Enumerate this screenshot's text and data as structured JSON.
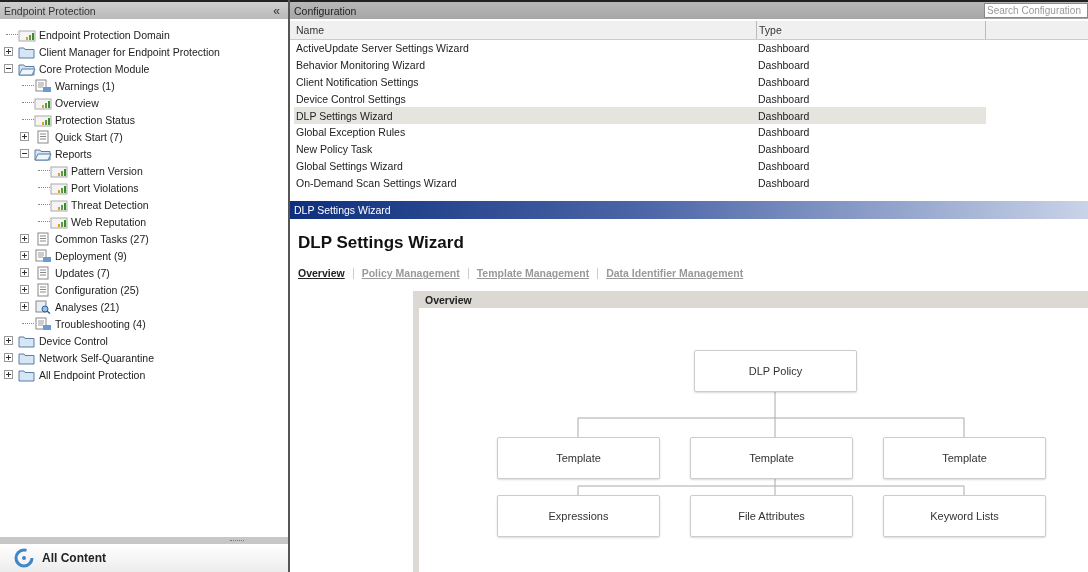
{
  "sidebar": {
    "title": "Endpoint Protection",
    "collapse": "«",
    "tree": [
      {
        "label": "Endpoint Protection Domain",
        "kind": "report"
      },
      {
        "label": "Client Manager for Endpoint Protection",
        "kind": "folder",
        "expanded": false
      },
      {
        "label": "Core Protection Module",
        "kind": "folder",
        "expanded": true,
        "children": [
          {
            "label": "Warnings (1)",
            "kind": "document"
          },
          {
            "label": "Overview",
            "kind": "report"
          },
          {
            "label": "Protection Status",
            "kind": "report"
          },
          {
            "label": "Quick Start (7)",
            "kind": "list",
            "expanded": false
          },
          {
            "label": "Reports",
            "kind": "folder",
            "expanded": true,
            "children": [
              {
                "label": "Pattern Version",
                "kind": "report"
              },
              {
                "label": "Port Violations",
                "kind": "report"
              },
              {
                "label": "Threat Detection",
                "kind": "report"
              },
              {
                "label": "Web Reputation",
                "kind": "report"
              }
            ]
          },
          {
            "label": "Common Tasks (27)",
            "kind": "list",
            "expanded": false
          },
          {
            "label": "Deployment (9)",
            "kind": "document",
            "expanded": false
          },
          {
            "label": "Updates (7)",
            "kind": "list",
            "expanded": false
          },
          {
            "label": "Configuration (25)",
            "kind": "list",
            "expanded": false
          },
          {
            "label": "Analyses (21)",
            "kind": "analysis",
            "expanded": false
          },
          {
            "label": "Troubleshooting (4)",
            "kind": "document"
          }
        ]
      },
      {
        "label": "Device Control",
        "kind": "folder",
        "expanded": false
      },
      {
        "label": "Network Self-Quarantine",
        "kind": "folder",
        "expanded": false
      },
      {
        "label": "All Endpoint Protection",
        "kind": "folder",
        "expanded": false
      }
    ],
    "footer": "All Content"
  },
  "configuration": {
    "title": "Configuration",
    "search": {
      "placeholder": "Search Configuration"
    },
    "table": {
      "columns": [
        "Name",
        "Type"
      ],
      "rows": [
        {
          "name": "ActiveUpdate Server Settings Wizard",
          "type": "Dashboard",
          "selected": false
        },
        {
          "name": "Behavior Monitoring Wizard",
          "type": "Dashboard",
          "selected": false
        },
        {
          "name": "Client Notification Settings",
          "type": "Dashboard",
          "selected": false
        },
        {
          "name": "Device Control Settings",
          "type": "Dashboard",
          "selected": false
        },
        {
          "name": "DLP Settings Wizard",
          "type": "Dashboard",
          "selected": true
        },
        {
          "name": "Global Exception Rules",
          "type": "Dashboard",
          "selected": false
        },
        {
          "name": "New Policy Task",
          "type": "Dashboard",
          "selected": false
        },
        {
          "name": "Global Settings Wizard",
          "type": "Dashboard",
          "selected": false
        },
        {
          "name": "On-Demand Scan Settings Wizard",
          "type": "Dashboard",
          "selected": false
        }
      ]
    }
  },
  "wizard": {
    "window_title": "DLP Settings Wizard",
    "heading": "DLP Settings Wizard",
    "tabs": [
      {
        "label": "Overview",
        "selected": true
      },
      {
        "label": "Policy Management",
        "selected": false
      },
      {
        "label": "Template Management",
        "selected": false
      },
      {
        "label": "Data Identifier Management",
        "selected": false
      }
    ],
    "panel": {
      "title": "Overview",
      "root": "DLP Policy",
      "templates": [
        "Template",
        "Template",
        "Template"
      ],
      "components": [
        "Expressions",
        "File Attributes",
        "Keyword Lists"
      ]
    }
  }
}
